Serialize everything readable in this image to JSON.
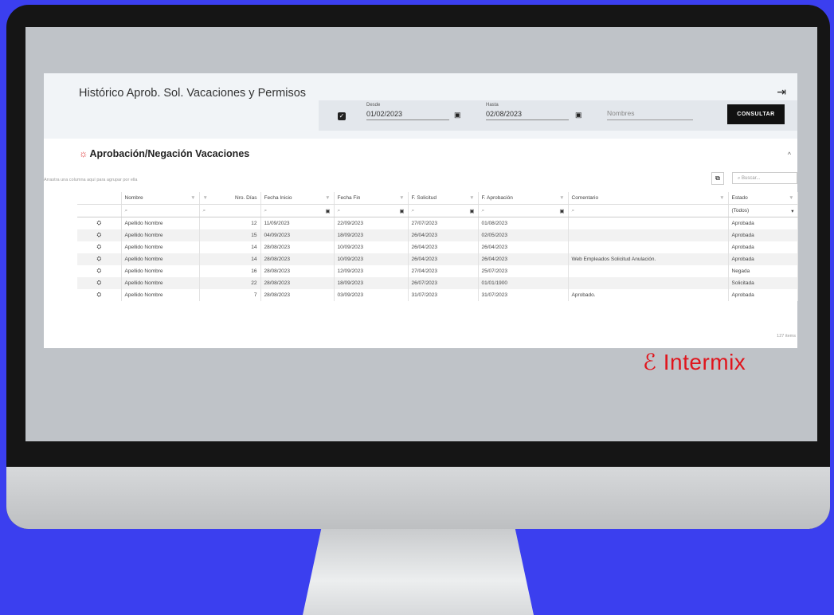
{
  "app": {
    "title": "Histórico Aprob. Sol. Vacaciones y Permisos",
    "filters": {
      "desde_label": "Desde",
      "desde_value": "01/02/2023",
      "hasta_label": "Hasta",
      "hasta_value": "02/08/2023",
      "nombres_placeholder": "Nombres",
      "consultar_label": "CONSULTAR"
    },
    "section_title": "Aprobación/Negación Vacaciones",
    "group_hint": "Arrastra una columna aquí para agrupar por ella",
    "search_placeholder": "Buscar...",
    "columns": [
      "Nombre",
      "Nro. Días",
      "Fecha Inicio",
      "Fecha Fin",
      "F. Solicitud",
      "F. Aprobación",
      "Comentario",
      "Estado"
    ],
    "estado_filter": "(Todos)",
    "rows": [
      {
        "nombre": "Apellido Nombre",
        "dias": "12",
        "inicio": "11/09/2023",
        "fin": "22/09/2023",
        "solicitud": "27/07/2023",
        "aprobacion": "01/08/2023",
        "comentario": "",
        "estado": "Aprobada"
      },
      {
        "nombre": "Apellido Nombre",
        "dias": "15",
        "inicio": "04/09/2023",
        "fin": "18/09/2023",
        "solicitud": "26/04/2023",
        "aprobacion": "02/05/2023",
        "comentario": "",
        "estado": "Aprobada"
      },
      {
        "nombre": "Apellido Nombre",
        "dias": "14",
        "inicio": "28/08/2023",
        "fin": "10/09/2023",
        "solicitud": "26/04/2023",
        "aprobacion": "26/04/2023",
        "comentario": "",
        "estado": "Aprobada"
      },
      {
        "nombre": "Apellido Nombre",
        "dias": "14",
        "inicio": "28/08/2023",
        "fin": "10/09/2023",
        "solicitud": "26/04/2023",
        "aprobacion": "26/04/2023",
        "comentario": "Web Empleados Solicitud Anulación.",
        "estado": "Aprobada"
      },
      {
        "nombre": "Apellido Nombre",
        "dias": "16",
        "inicio": "28/08/2023",
        "fin": "12/09/2023",
        "solicitud": "27/04/2023",
        "aprobacion": "25/07/2023",
        "comentario": "",
        "estado": "Negada"
      },
      {
        "nombre": "Apellido Nombre",
        "dias": "22",
        "inicio": "28/08/2023",
        "fin": "18/09/2023",
        "solicitud": "26/07/2023",
        "aprobacion": "01/01/1900",
        "comentario": "",
        "estado": "Solicitada"
      },
      {
        "nombre": "Apellido Nombre",
        "dias": "7",
        "inicio": "28/08/2023",
        "fin": "03/09/2023",
        "solicitud": "31/07/2023",
        "aprobacion": "31/07/2023",
        "comentario": "Aprobado.",
        "estado": "Aprobada"
      }
    ],
    "footer_count": "127 items",
    "logo_text": "Intermix"
  },
  "colors": {
    "background": "#3b3fef",
    "accent": "#e0141c",
    "button": "#111111"
  },
  "icons": [
    "exit-icon",
    "calendar-icon",
    "filter-icon",
    "search-icon",
    "row-action-icon",
    "export-icon",
    "caret-up-icon"
  ]
}
